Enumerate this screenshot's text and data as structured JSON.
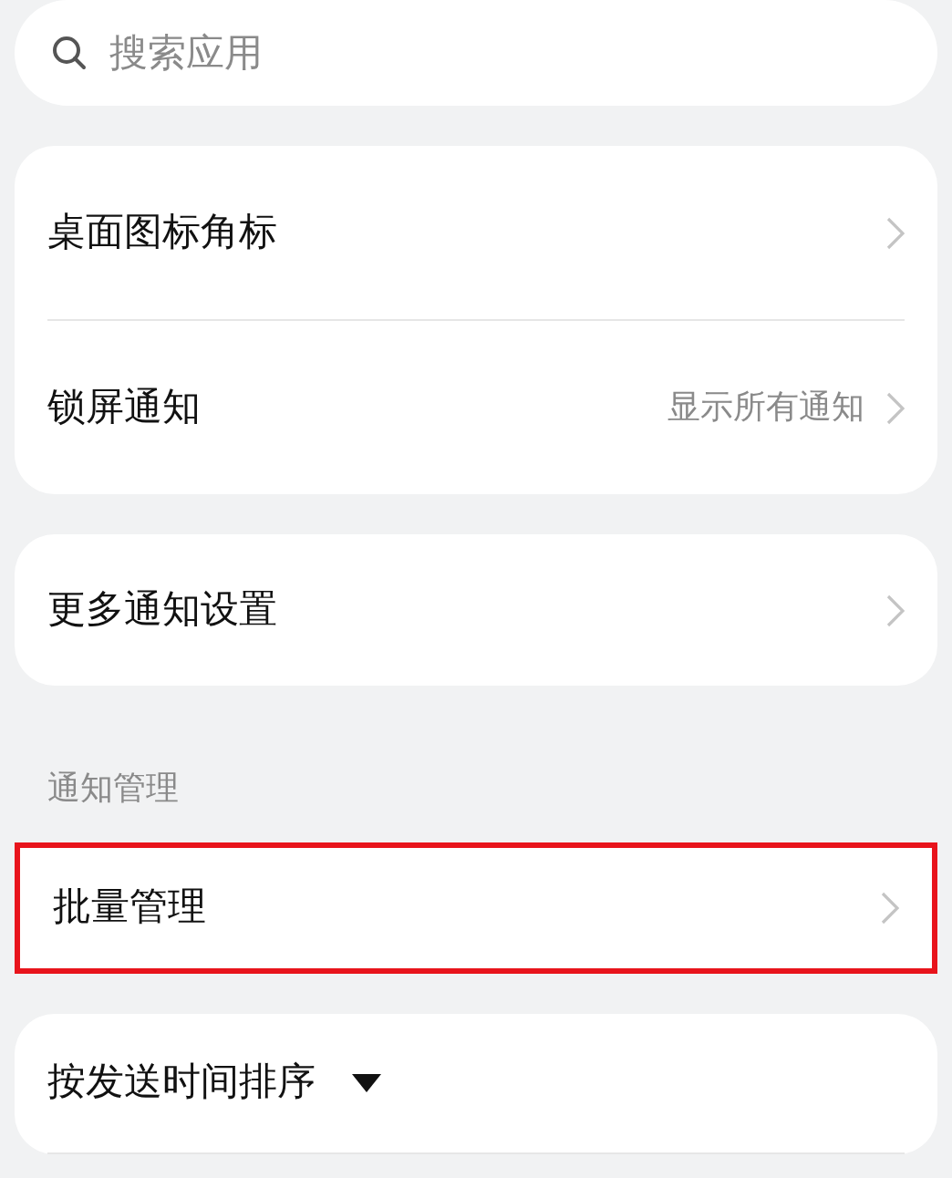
{
  "search": {
    "placeholder": "搜索应用"
  },
  "groups": [
    {
      "items": [
        {
          "label": "桌面图标角标",
          "kind": "chevron",
          "highlighted": false
        },
        {
          "label": "锁屏通知",
          "value": "显示所有通知",
          "kind": "chevron",
          "highlighted": false
        }
      ]
    },
    {
      "items": [
        {
          "label": "更多通知设置",
          "kind": "chevron",
          "highlighted": false
        }
      ]
    },
    {
      "header": "通知管理",
      "items": [
        {
          "label": "批量管理",
          "kind": "chevron",
          "highlighted": true
        }
      ]
    },
    {
      "items": [
        {
          "label": "按发送时间排序",
          "kind": "dropdown",
          "highlighted": false
        }
      ]
    }
  ]
}
